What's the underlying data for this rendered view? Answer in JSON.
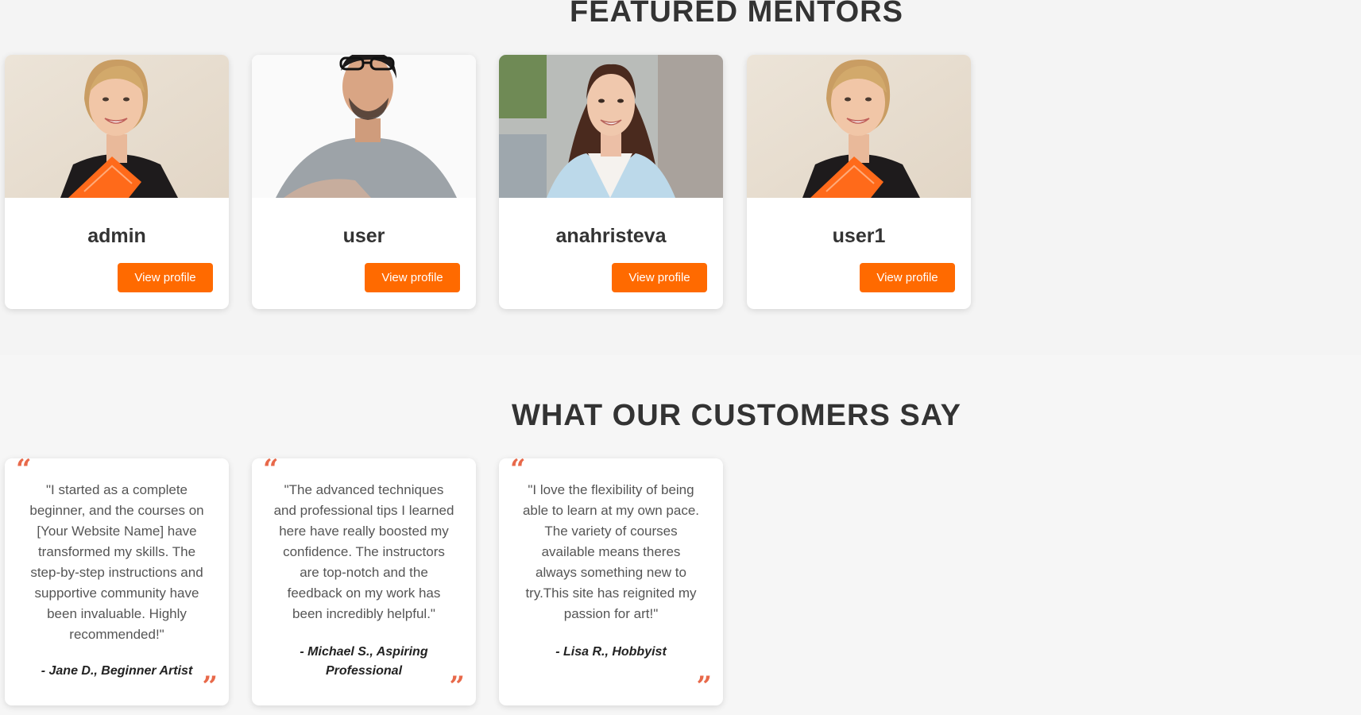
{
  "mentors_section": {
    "title": "FEATURED MENTORS",
    "view_profile_label": "View profile",
    "mentors": [
      {
        "name": "admin",
        "photo": "mentor-photo-woman-blonde-orange-folder"
      },
      {
        "name": "user",
        "photo": "mentor-photo-man-glasses-grey-tshirt"
      },
      {
        "name": "anahristeva",
        "photo": "mentor-photo-woman-brunette-blue-blazer"
      },
      {
        "name": "user1",
        "photo": "mentor-photo-woman-blonde-orange-folder"
      }
    ]
  },
  "testimonials_section": {
    "title": "WHAT OUR CUSTOMERS SAY",
    "open_quote_glyph": "“",
    "close_quote_glyph": "”",
    "testimonials": [
      {
        "text": "\"I started as a complete beginner, and the courses on [Your Website Name] have transformed my skills. The step-by-step instructions and supportive community have been invaluable. Highly recommended!\"",
        "author": "- Jane D., Beginner Artist"
      },
      {
        "text": "\"The advanced techniques and professional tips I learned here have really boosted my confidence. The instructors are top-notch and the feedback on my work has been incredibly helpful.\"",
        "author": "- Michael S., Aspiring Professional"
      },
      {
        "text": "\"I love the flexibility of being able to learn at my own pace. The variety of courses available means theres always something new to try.This site has reignited my passion for art!\"",
        "author": "- Lisa R., Hobbyist"
      }
    ]
  },
  "colors": {
    "accent": "#ff6a00",
    "quote_mark": "#e8694a",
    "page_background": "#f4f4f4",
    "card_background": "#ffffff",
    "heading_text": "#333333"
  }
}
